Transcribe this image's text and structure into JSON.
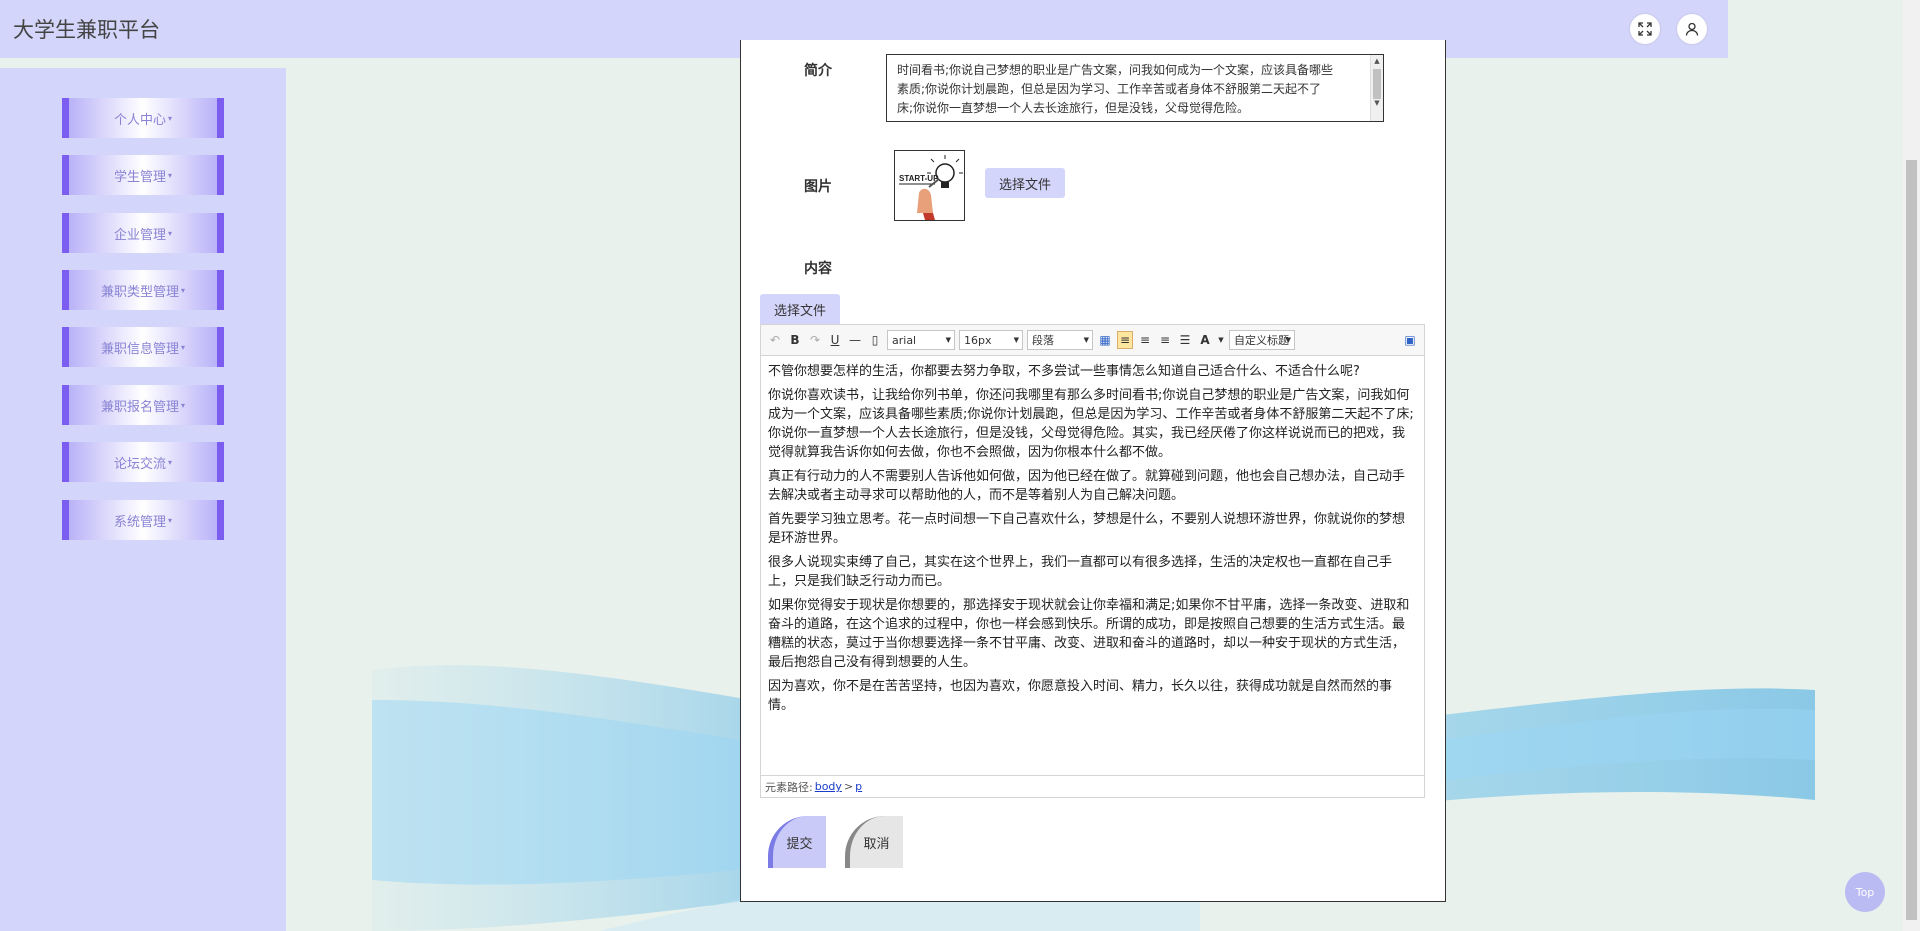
{
  "header": {
    "title": "大学生兼职平台"
  },
  "sidebar": {
    "items": [
      {
        "label": "个人中心"
      },
      {
        "label": "学生管理"
      },
      {
        "label": "企业管理"
      },
      {
        "label": "兼职类型管理"
      },
      {
        "label": "兼职信息管理"
      },
      {
        "label": "兼职报名管理"
      },
      {
        "label": "论坛交流"
      },
      {
        "label": "系统管理"
      }
    ]
  },
  "form": {
    "intro_label": "简介",
    "intro_lines": [
      "时间看书;你说自己梦想的职业是广告文案，问我如何成为一个文案，应该具备哪些",
      "素质;你说你计划晨跑，但总是因为学习、工作辛苦或者身体不舒服第二天起不了",
      "床;你说你一直梦想一个人去长途旅行，但是没钱，父母觉得危险。"
    ],
    "image_label": "图片",
    "image_upload_label": "选择文件",
    "content_label": "内容",
    "content_upload_label": "选择文件",
    "submit_label": "提交",
    "cancel_label": "取消"
  },
  "editor": {
    "font_family": "arial",
    "font_size": "16px",
    "paragraph_format": "段落",
    "custom_title": "自定义标题",
    "path_prefix": "元素路径:",
    "path_body": "body",
    "path_sep": ">",
    "path_p": "p",
    "paragraphs": [
      "不管你想要怎样的生活，你都要去努力争取，不多尝试一些事情怎么知道自己适合什么、不适合什么呢?",
      "你说你喜欢读书，让我给你列书单，你还问我哪里有那么多时间看书;你说自己梦想的职业是广告文案，问我如何成为一个文案，应该具备哪些素质;你说你计划晨跑，但总是因为学习、工作辛苦或者身体不舒服第二天起不了床;你说你一直梦想一个人去长途旅行，但是没钱，父母觉得危险。其实，我已经厌倦了你这样说说而已的把戏，我觉得就算我告诉你如何去做，你也不会照做，因为你根本什么都不做。",
      "真正有行动力的人不需要别人告诉他如何做，因为他已经在做了。就算碰到问题，他也会自己想办法，自己动手去解决或者主动寻求可以帮助他的人，而不是等着别人为自己解决问题。",
      "首先要学习独立思考。花一点时间想一下自己喜欢什么，梦想是什么，不要别人说想环游世界，你就说你的梦想是环游世界。",
      "很多人说现实束缚了自己，其实在这个世界上，我们一直都可以有很多选择，生活的决定权也一直都在自己手上，只是我们缺乏行动力而已。",
      "如果你觉得安于现状是你想要的，那选择安于现状就会让你幸福和满足;如果你不甘平庸，选择一条改变、进取和奋斗的道路，在这个追求的过程中，你也一样会感到快乐。所谓的成功，即是按照自己想要的生活方式生活。最糟糕的状态，莫过于当你想要选择一条不甘平庸、改变、进取和奋斗的道路时，却以一种安于现状的方式生活，最后抱怨自己没有得到想要的人生。",
      "因为喜欢，你不是在苦苦坚持，也因为喜欢，你愿意投入时间、精力，长久以往，获得成功就是自然而然的事情。"
    ]
  },
  "image_preview": {
    "text": "START-UP"
  },
  "back_to_top": "Top",
  "colors": {
    "header_bg": "#d4d5fa",
    "menu_edge": "#7b5df0",
    "page_bg": "#e8f1ec"
  }
}
